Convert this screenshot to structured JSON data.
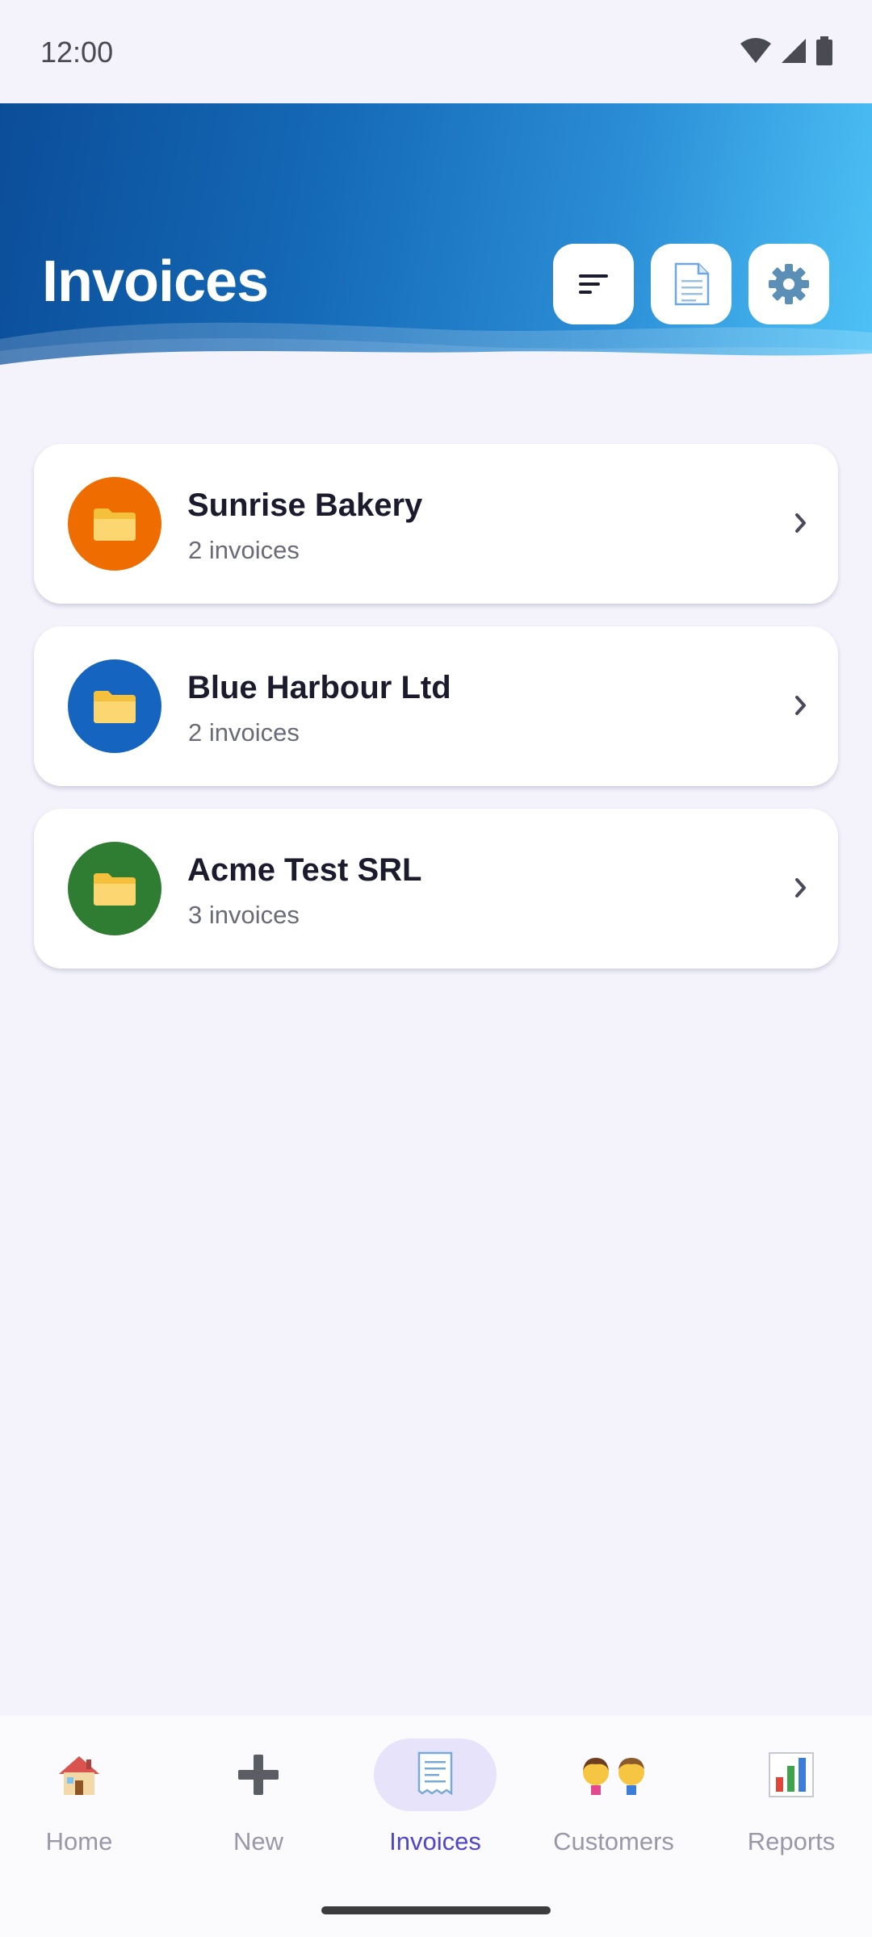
{
  "status": {
    "time": "12:00"
  },
  "header": {
    "title": "Invoices",
    "gradient_start": "#0b4d99",
    "gradient_end": "#4ec3f7",
    "actions": [
      {
        "icon": "sort-icon"
      },
      {
        "icon": "document-icon"
      },
      {
        "icon": "gear-icon"
      }
    ]
  },
  "customers": [
    {
      "name": "Sunrise Bakery",
      "count": "2 invoices",
      "color": "#ef6c00",
      "icon": "folder-icon"
    },
    {
      "name": "Blue Harbour Ltd",
      "count": "2 invoices",
      "color": "#1565c0",
      "icon": "folder-icon"
    },
    {
      "name": "Acme Test SRL",
      "count": "3 invoices",
      "color": "#2e7d32",
      "icon": "folder-icon"
    }
  ],
  "nav": {
    "items": [
      {
        "label": "Home",
        "icon": "house-icon"
      },
      {
        "label": "New",
        "icon": "plus-icon"
      },
      {
        "label": "Invoices",
        "icon": "receipt-icon"
      },
      {
        "label": "Customers",
        "icon": "people-icon"
      },
      {
        "label": "Reports",
        "icon": "bar-chart-icon"
      }
    ],
    "active_index": 2,
    "active_color": "#4f47c9"
  }
}
